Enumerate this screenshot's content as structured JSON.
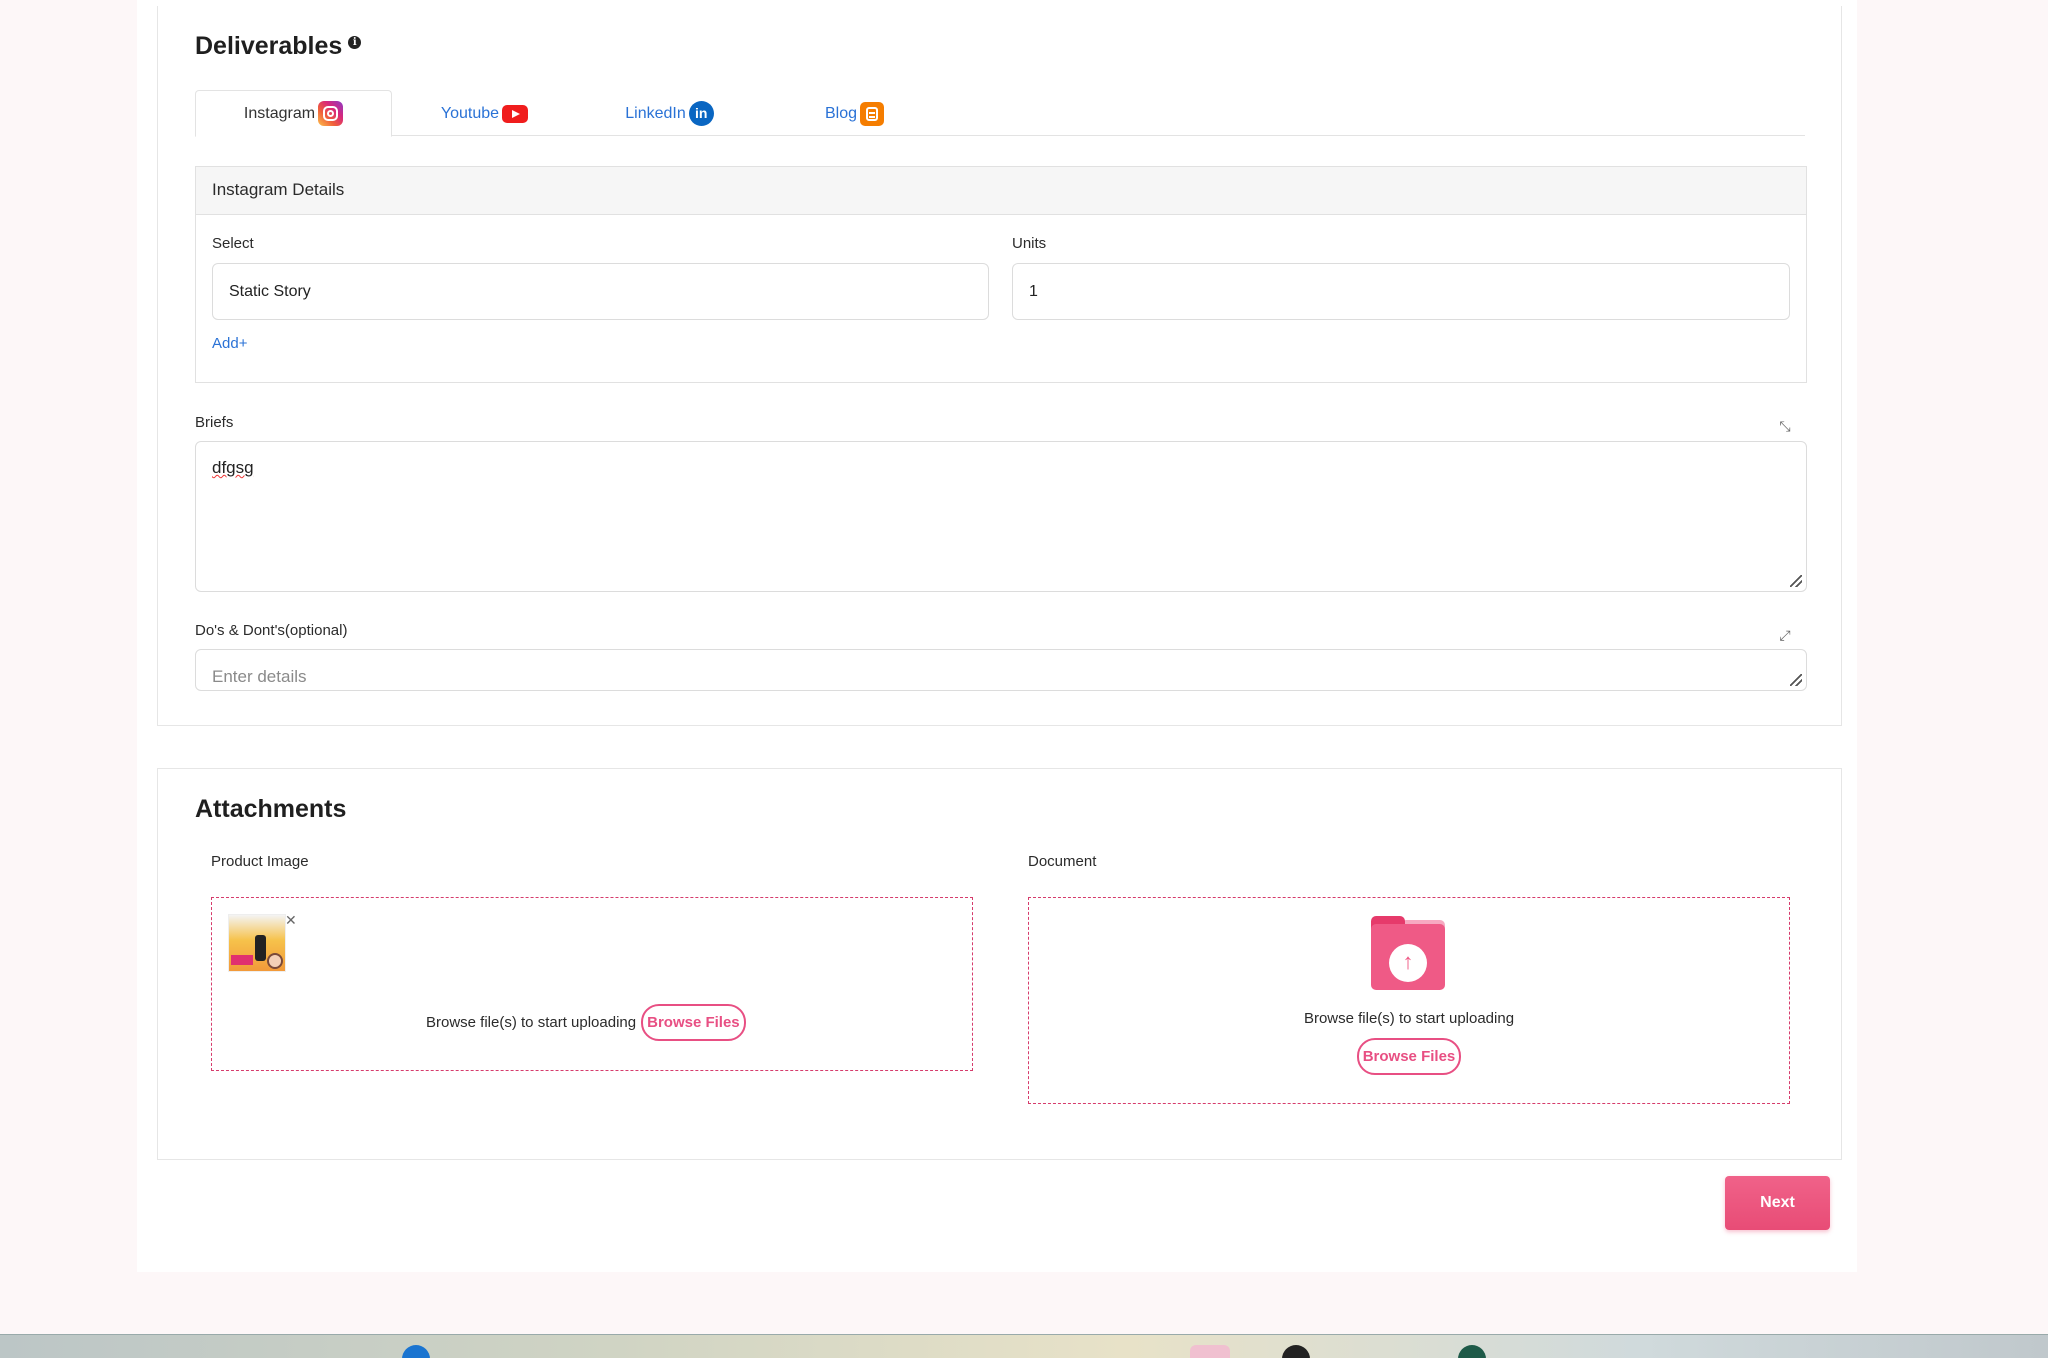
{
  "deliverables": {
    "title": "Deliverables",
    "info_icon": "i",
    "tabs": [
      {
        "label": "Instagram",
        "icon": "instagram-icon",
        "active": true
      },
      {
        "label": "Youtube",
        "icon": "youtube-icon",
        "active": false
      },
      {
        "label": "LinkedIn",
        "icon": "linkedin-icon",
        "active": false
      },
      {
        "label": "Blog",
        "icon": "blogger-icon",
        "active": false
      }
    ],
    "details": {
      "header": "Instagram Details",
      "select_label": "Select",
      "select_value": "Static Story",
      "units_label": "Units",
      "units_value": "1",
      "add_link": "Add+"
    },
    "briefs": {
      "label": "Briefs",
      "value": "dfgsg"
    },
    "dos_donts": {
      "label": "Do's & Dont's(optional)",
      "placeholder": "Enter details"
    }
  },
  "attachments": {
    "title": "Attachments",
    "product_image": {
      "label": "Product Image",
      "prompt": "Browse file(s) to start uploading",
      "button": "Browse Files"
    },
    "document": {
      "label": "Document",
      "prompt": "Browse file(s) to start uploading",
      "button": "Browse Files"
    }
  },
  "actions": {
    "next_label": "Next"
  },
  "colors": {
    "accent_pink": "#e84f83",
    "link_blue": "#2a72d6"
  }
}
